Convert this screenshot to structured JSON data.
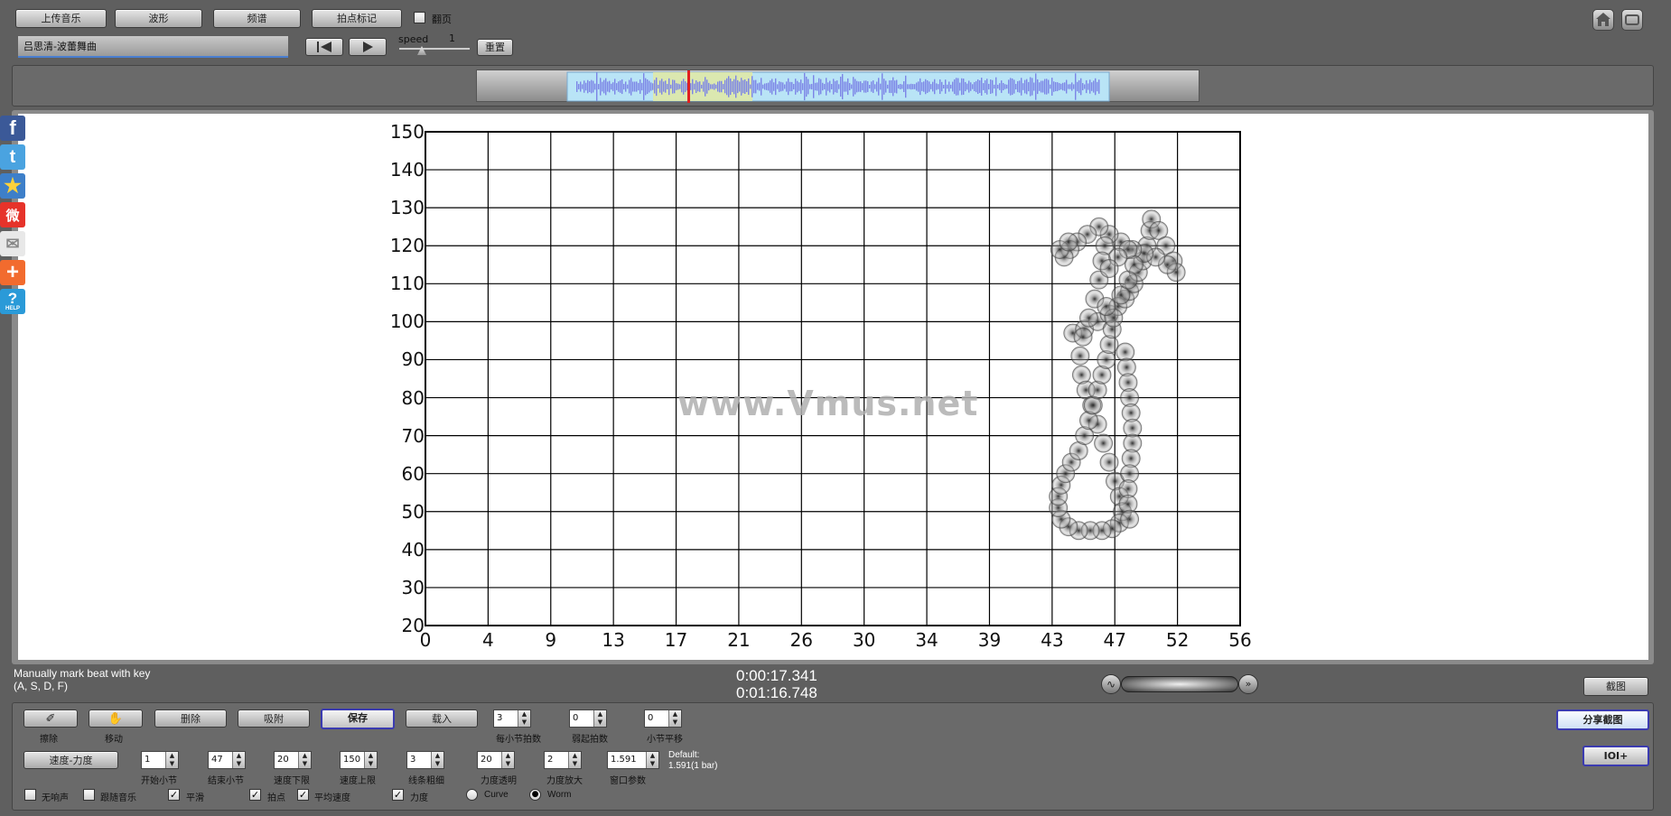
{
  "toolbar_top": {
    "upload_music": "上传音乐",
    "waveform": "波形",
    "spectrum": "频谱",
    "beat_mark": "拍点标记",
    "flip_page": "翻页",
    "song_title": "吕思清-波蕾舞曲",
    "speed_label": "speed",
    "speed_value": "1",
    "reset": "重置"
  },
  "chart_data": {
    "type": "scatter",
    "title": "",
    "xlabel": "",
    "ylabel": "",
    "x_ticks": [
      "0",
      "4",
      "9",
      "13",
      "17",
      "21",
      "26",
      "30",
      "34",
      "39",
      "43",
      "47",
      "52",
      "56"
    ],
    "y_ticks": [
      "150",
      "140",
      "130",
      "120",
      "110",
      "100",
      "90",
      "80",
      "70",
      "60",
      "50",
      "40",
      "30",
      "20"
    ],
    "xlim": [
      0,
      56
    ],
    "ylim": [
      20,
      150
    ],
    "grid": true,
    "watermark": "www.Vmus.net",
    "worm_points": [
      [
        44.5,
        97
      ],
      [
        45.3,
        98
      ],
      [
        46.2,
        100
      ],
      [
        47.0,
        102
      ],
      [
        47.6,
        104
      ],
      [
        48.1,
        106
      ],
      [
        48.4,
        108
      ],
      [
        48.7,
        110
      ],
      [
        49.0,
        113
      ],
      [
        49.3,
        116
      ],
      [
        49.6,
        120
      ],
      [
        49.8,
        124
      ],
      [
        49.9,
        127
      ],
      [
        50.4,
        124
      ],
      [
        50.9,
        120
      ],
      [
        51.4,
        116
      ],
      [
        51.6,
        113
      ],
      [
        51.0,
        115
      ],
      [
        50.2,
        117
      ],
      [
        49.4,
        118
      ],
      [
        48.6,
        119
      ],
      [
        47.8,
        121
      ],
      [
        47.0,
        123
      ],
      [
        46.3,
        125
      ],
      [
        45.5,
        123
      ],
      [
        44.8,
        121
      ],
      [
        44.3,
        119
      ],
      [
        43.9,
        117
      ],
      [
        43.6,
        119
      ],
      [
        44.2,
        121
      ],
      [
        46.7,
        120
      ],
      [
        46.5,
        116
      ],
      [
        46.3,
        111
      ],
      [
        46.0,
        106
      ],
      [
        45.6,
        101
      ],
      [
        45.2,
        96
      ],
      [
        45.0,
        91
      ],
      [
        45.1,
        86
      ],
      [
        45.4,
        82
      ],
      [
        45.8,
        78
      ],
      [
        46.2,
        73
      ],
      [
        46.6,
        68
      ],
      [
        47.0,
        63
      ],
      [
        47.4,
        58
      ],
      [
        47.7,
        54
      ],
      [
        47.9,
        50
      ],
      [
        47.7,
        47
      ],
      [
        47.2,
        45.5
      ],
      [
        46.5,
        45
      ],
      [
        45.7,
        45
      ],
      [
        44.9,
        45
      ],
      [
        44.2,
        46
      ],
      [
        43.7,
        48
      ],
      [
        43.5,
        51
      ],
      [
        43.5,
        54
      ],
      [
        43.7,
        57
      ],
      [
        44.0,
        60
      ],
      [
        44.4,
        63
      ],
      [
        44.9,
        66
      ],
      [
        45.3,
        70
      ],
      [
        45.6,
        74
      ],
      [
        45.9,
        78
      ],
      [
        46.2,
        82
      ],
      [
        46.5,
        86
      ],
      [
        46.8,
        90
      ],
      [
        47.0,
        94
      ],
      [
        47.2,
        98
      ],
      [
        48.1,
        92
      ],
      [
        48.2,
        88
      ],
      [
        48.3,
        84
      ],
      [
        48.4,
        80
      ],
      [
        48.5,
        76
      ],
      [
        48.6,
        72
      ],
      [
        48.6,
        68
      ],
      [
        48.5,
        64
      ],
      [
        48.4,
        60
      ],
      [
        48.3,
        56
      ],
      [
        48.3,
        52
      ],
      [
        48.4,
        48
      ],
      [
        47.3,
        101
      ],
      [
        46.8,
        104
      ],
      [
        47.8,
        107
      ],
      [
        48.3,
        111
      ],
      [
        48.7,
        115
      ],
      [
        48.3,
        119
      ],
      [
        47.6,
        117
      ],
      [
        47.0,
        114
      ]
    ],
    "worm_type": "Worm"
  },
  "status": {
    "hint_line1": "Manually mark beat with key",
    "hint_line2": "(A, S, D, F)",
    "time_current": "0:00:17.341",
    "time_total": "0:01:16.748",
    "screenshot": "截图"
  },
  "controls": {
    "erase": "擦除",
    "move": "移动",
    "delete": "删除",
    "snap": "吸附",
    "save": "保存",
    "load": "载入",
    "beats_per_bar_val": "3",
    "beats_per_bar": "每小节拍数",
    "upbeat_val": "0",
    "upbeat": "弱起拍数",
    "bar_shift_val": "0",
    "bar_shift": "小节平移",
    "tempo_dynamics": "速度-力度",
    "start_bar_val": "1",
    "start_bar": "开始小节",
    "end_bar_val": "47",
    "end_bar": "结束小节",
    "tempo_min_val": "20",
    "tempo_min": "速度下限",
    "tempo_max_val": "150",
    "tempo_max": "速度上限",
    "line_width_val": "3",
    "line_width": "线条粗细",
    "dyn_alpha_val": "20",
    "dyn_alpha": "力度透明",
    "dyn_scale_val": "2",
    "dyn_scale": "力度放大",
    "window_val": "1.591",
    "window": "窗口参数",
    "default_label": "Default:",
    "default_value": "1.591(1 bar)",
    "share_screenshot": "分享截图",
    "ioi": "IOI+",
    "no_sound": "无响声",
    "follow_music": "跟随音乐",
    "smooth": "平滑",
    "beat_point": "拍点",
    "avg_tempo": "平均速度",
    "dynamics": "力度",
    "curve": "Curve",
    "worm": "Worm"
  },
  "share_bar": [
    "facebook",
    "twitter",
    "favorite",
    "weibo",
    "email",
    "add",
    "help"
  ],
  "help_text": "HELP",
  "colors": {
    "background": "#5f5f5f",
    "waveform": "#7c84e6",
    "waveform_bg": "#b9e4f6",
    "playhead": "#e02020",
    "selection": "#dfe8a8"
  }
}
